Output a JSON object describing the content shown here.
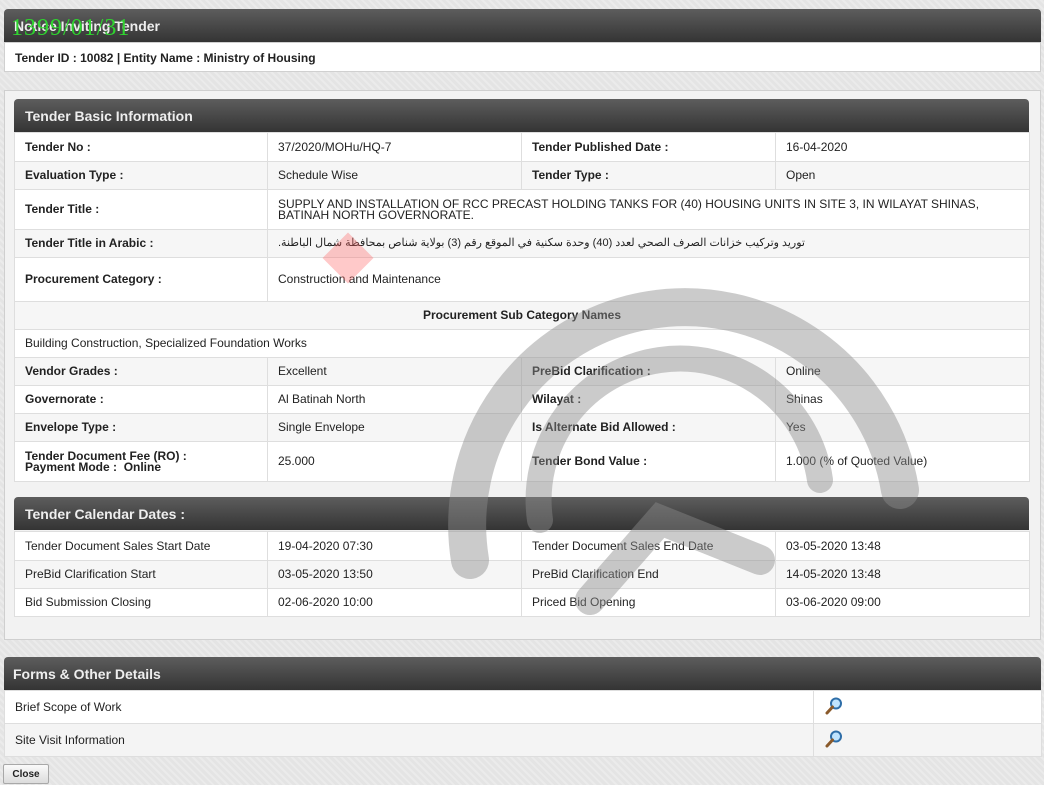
{
  "window": {
    "title": "Notice Inviting Tender",
    "date_stamp": "1399/01/31",
    "id_line": "Tender ID : 10082 | Entity Name : Ministry of Housing"
  },
  "basic": {
    "title": "Tender Basic Information",
    "tender_no_label": "Tender No :",
    "tender_no": "37/2020/MOHu/HQ-7",
    "published_label": "Tender Published Date :",
    "published": "16-04-2020",
    "eval_label": "Evaluation Type :",
    "eval": "Schedule Wise",
    "type_label": "Tender Type :",
    "type": "Open",
    "title_label": "Tender Title :",
    "tender_title": "SUPPLY AND INSTALLATION OF RCC PRECAST HOLDING TANKS FOR (40) HOUSING UNITS IN SITE 3, IN WILAYAT SHINAS, BATINAH NORTH GOVERNORATE.",
    "title_ar_label": "Tender Title in Arabic :",
    "tender_title_ar": "توريد وتركيب خزانات الصرف الصحي لعدد (40) وحدة سكنية في الموقع رقم (3) بولاية شناص بمحافظة شمال الباطنة.",
    "proc_cat_label": "Procurement Category :",
    "proc_cat": "Construction and Maintenance",
    "sub_cat_header": "Procurement Sub Category Names",
    "sub_cat": "Building Construction, Specialized Foundation Works",
    "grades_label": "Vendor Grades :",
    "grades": "Excellent",
    "prebid_label": "PreBid Clarification :",
    "prebid": "Online",
    "gov_label": "Governorate :",
    "gov": "Al Batinah North",
    "wilayat_label": "Wilayat :",
    "wilayat": "Shinas",
    "envelope_label": "Envelope Type :",
    "envelope": "Single Envelope",
    "alt_label": "Is Alternate Bid Allowed :",
    "alt": "Yes",
    "fee_label": "Tender Document Fee (RO) :",
    "payment_label": "Payment Mode :",
    "payment": "Online",
    "fee": "25.000",
    "bond_label": "Tender Bond Value :",
    "bond": "1.000 (% of Quoted Value)"
  },
  "calendar": {
    "title": "Tender Calendar Dates :",
    "rows": [
      {
        "l1": "Tender Document Sales Start Date",
        "v1": "19-04-2020 07:30",
        "l2": "Tender Document Sales End Date",
        "v2": "03-05-2020 13:48"
      },
      {
        "l1": "PreBid Clarification Start",
        "v1": "03-05-2020 13:50",
        "l2": "PreBid Clarification End",
        "v2": "14-05-2020 13:48"
      },
      {
        "l1": "Bid Submission Closing",
        "v1": "02-06-2020 10:00",
        "l2": "Priced Bid Opening",
        "v2": "03-06-2020 09:00"
      }
    ]
  },
  "forms": {
    "title": "Forms & Other Details",
    "items": [
      "Brief Scope of Work",
      "Site Visit Information"
    ]
  },
  "buttons": {
    "close": "Close"
  },
  "icons": {
    "view": "magnifier-icon"
  }
}
